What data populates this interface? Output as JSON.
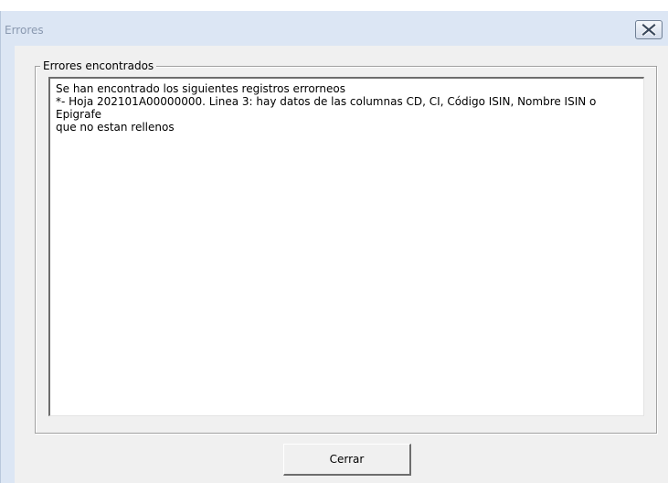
{
  "window": {
    "title": "Errores"
  },
  "icons": {
    "close": "close-icon"
  },
  "groupbox": {
    "label": "Errores encontrados"
  },
  "errors_text": {
    "lines": [
      "Se han encontrado los siguientes registros errorneos",
      "*- Hoja 202101A00000000. Linea 3: hay datos de las columnas CD, CI, Código ISIN, Nombre ISIN o Epigrafe",
      "que no estan rellenos"
    ]
  },
  "buttons": {
    "close_label": "Cerrar"
  },
  "colors": {
    "title_text": "#8a99b0",
    "frame": "#dce6f4",
    "dialog_background": "#f0f0f0"
  }
}
